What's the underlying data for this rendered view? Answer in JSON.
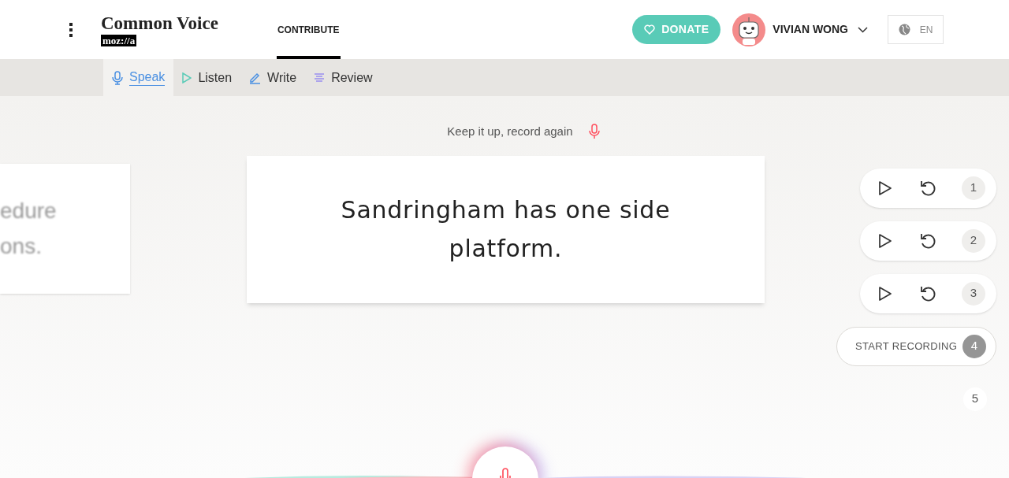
{
  "header": {
    "brand": {
      "title": "Common Voice",
      "sub": "moz://a"
    },
    "nav": [
      {
        "label": "CONTRIBUTE",
        "selected": true
      }
    ],
    "donate": "DONATE",
    "user": "VIVIAN WONG",
    "language": "EN"
  },
  "tabs": [
    {
      "label": "Speak",
      "kind": "speak",
      "selected": true
    },
    {
      "label": "Listen",
      "kind": "listen",
      "selected": false
    },
    {
      "label": "Write",
      "kind": "write",
      "selected": false
    },
    {
      "label": "Review",
      "kind": "review",
      "selected": false
    }
  ],
  "prompt": "Keep it up, record again",
  "previous_card": {
    "lines": [
      "edure",
      "ons."
    ]
  },
  "sentence": "Sandringham has one side platform.",
  "clips": [
    {
      "kind": "recorded",
      "number": "1"
    },
    {
      "kind": "recorded",
      "number": "2"
    },
    {
      "kind": "recorded",
      "number": "3"
    },
    {
      "kind": "current",
      "label": "START RECORDING",
      "number": "4"
    },
    {
      "kind": "pending",
      "number": "5"
    }
  ]
}
